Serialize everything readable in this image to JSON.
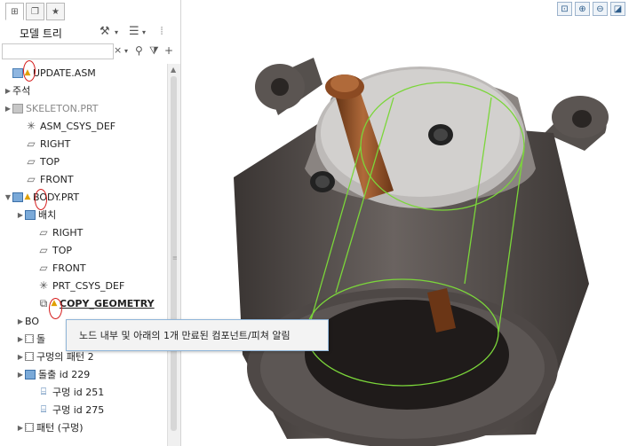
{
  "panel": {
    "title": "모델 트리",
    "filter_placeholder": "",
    "tab_icons": [
      "tree-tab-icon",
      "layers-tab-icon",
      "favorites-tab-icon"
    ]
  },
  "tree": [
    {
      "label": "UPDATE.ASM",
      "icon": "assembly-icon",
      "warn": true,
      "expand": "",
      "indent": 0,
      "style": ""
    },
    {
      "label": "주석",
      "icon": "",
      "warn": false,
      "expand": "▶",
      "indent": 0,
      "style": ""
    },
    {
      "label": "SKELETON.PRT",
      "icon": "skeleton-icon",
      "warn": false,
      "expand": "▶",
      "indent": 0,
      "style": "grey"
    },
    {
      "label": "ASM_CSYS_DEF",
      "icon": "csys-icon",
      "warn": false,
      "expand": "",
      "indent": 1,
      "style": ""
    },
    {
      "label": "RIGHT",
      "icon": "plane-icon",
      "warn": false,
      "expand": "",
      "indent": 1,
      "style": ""
    },
    {
      "label": "TOP",
      "icon": "plane-icon",
      "warn": false,
      "expand": "",
      "indent": 1,
      "style": ""
    },
    {
      "label": "FRONT",
      "icon": "plane-icon",
      "warn": false,
      "expand": "",
      "indent": 1,
      "style": ""
    },
    {
      "label": "BODY.PRT",
      "icon": "part-icon",
      "warn": true,
      "expand": "▼",
      "indent": 0,
      "style": ""
    },
    {
      "label": "배치",
      "icon": "part-icon",
      "warn": false,
      "expand": "▶",
      "indent": 1,
      "style": ""
    },
    {
      "label": "RIGHT",
      "icon": "plane-icon",
      "warn": false,
      "expand": "",
      "indent": 2,
      "style": ""
    },
    {
      "label": "TOP",
      "icon": "plane-icon",
      "warn": false,
      "expand": "",
      "indent": 2,
      "style": ""
    },
    {
      "label": "FRONT",
      "icon": "plane-icon",
      "warn": false,
      "expand": "",
      "indent": 2,
      "style": ""
    },
    {
      "label": "PRT_CSYS_DEF",
      "icon": "csys-icon",
      "warn": false,
      "expand": "",
      "indent": 2,
      "style": ""
    },
    {
      "label": "COPY_GEOMETRY",
      "icon": "copy-geom-icon",
      "warn": true,
      "expand": "",
      "indent": 2,
      "style": "bold"
    },
    {
      "label": "BO",
      "icon": "",
      "warn": false,
      "expand": "▶",
      "indent": 1,
      "style": ""
    },
    {
      "label": "돌",
      "icon": "pattern-icon",
      "warn": false,
      "expand": "▶",
      "indent": 1,
      "style": ""
    },
    {
      "label": "구멍의 패턴 2",
      "icon": "pattern-icon",
      "warn": false,
      "expand": "▶",
      "indent": 1,
      "style": ""
    },
    {
      "label": "돌출 id 229",
      "icon": "part-icon",
      "warn": false,
      "expand": "▶",
      "indent": 1,
      "style": ""
    },
    {
      "label": "구멍 id 251",
      "icon": "hole-icon",
      "warn": false,
      "expand": "",
      "indent": 2,
      "style": ""
    },
    {
      "label": "구멍 id 275",
      "icon": "hole-icon",
      "warn": false,
      "expand": "",
      "indent": 2,
      "style": ""
    },
    {
      "label": "패턴 (구멍)",
      "icon": "pattern-icon",
      "warn": false,
      "expand": "▶",
      "indent": 1,
      "style": ""
    }
  ],
  "tooltip": {
    "text": "노드 내부 및 아래의 1개 만료된 컴포넌트/피쳐 알림"
  },
  "colors": {
    "highlight_circle": "#d51b1b",
    "warning": "#e0a000",
    "edge_highlight": "#7bd63a",
    "part_body": "#4a4543",
    "shaft": "#8b4a22"
  }
}
